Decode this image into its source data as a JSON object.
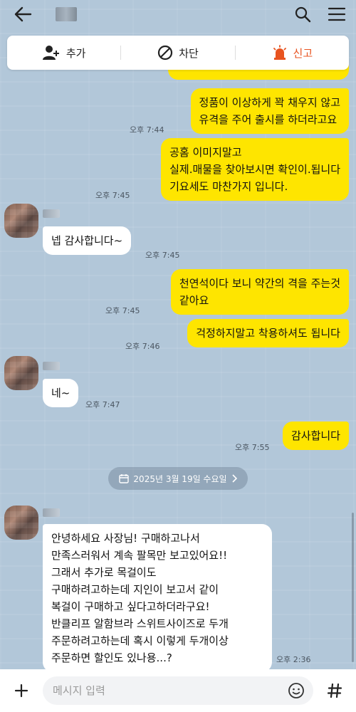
{
  "actions": {
    "add_label": "추가",
    "block_label": "차단",
    "report_label": "신고"
  },
  "messages": [
    {
      "from": "me",
      "text": "정품이 이상하게 꽉 채우지 않고\n유격을 주어 출시를 하더라고요",
      "time": "오후 7:44"
    },
    {
      "from": "me",
      "text": "공홈 이미지말고\n실제.매물을 찾아보시면 확인이.됩니다\n기요세도 마찬가지 입니다.",
      "time": "오후 7:45"
    },
    {
      "from": "other",
      "text": "넵 감사합니다~",
      "time": "오후 7:45"
    },
    {
      "from": "me",
      "text": "천연석이다 보니 약간의 격을 주는것\n같아요",
      "time": "오후 7:45"
    },
    {
      "from": "me",
      "text": "걱정하지말고 착용하셔도 됩니다",
      "time": "오후 7:46"
    },
    {
      "from": "other",
      "text": "네~",
      "time": "오후 7:47"
    },
    {
      "from": "me",
      "text": "감사합니다",
      "time": "오후 7:55"
    },
    {
      "from": "other",
      "text": "안녕하세요 사장님! 구매하고나서\n만족스러워서 계속 팔목만 보고있어요!!\n그래서 추가로 목걸이도\n구매하려고하는데 지인이 보고서 같이\n복걸이 구매하고 싶다고하더라구요!\n반클리프 알함브라 스위트사이즈로 두개\n주문하려고하는데 혹시 이렇게 두개이상\n주문하면 할인도 있나용...?",
      "time": "오후 2:36"
    }
  ],
  "date_divider": "2025년 3월 19일 수요일",
  "input": {
    "placeholder": "메시지 입력"
  },
  "colors": {
    "background": "#b2c7d9",
    "my_bubble": "#fee500",
    "other_bubble": "#ffffff",
    "report_accent": "#e8531f"
  }
}
